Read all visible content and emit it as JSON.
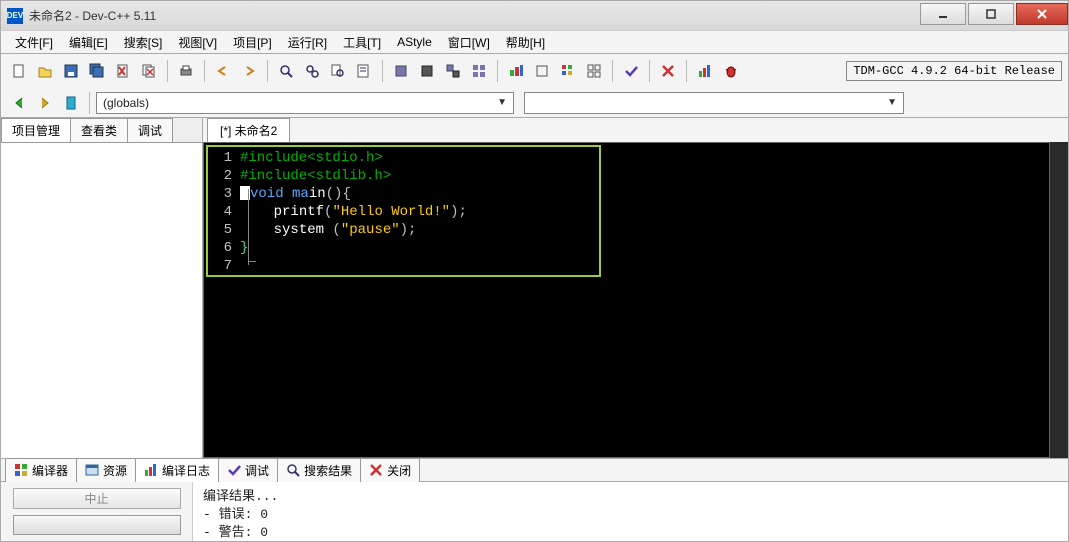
{
  "window": {
    "title": "未命名2 - Dev-C++ 5.11",
    "app_abbrev": "DEV"
  },
  "menu": {
    "file": "文件[F]",
    "edit": "编辑[E]",
    "search": "搜索[S]",
    "view": "视图[V]",
    "project": "项目[P]",
    "run": "运行[R]",
    "tools": "工具[T]",
    "astyle": "AStyle",
    "window": "窗口[W]",
    "help": "帮助[H]"
  },
  "toolbar2": {
    "scope_combo": "(globals)",
    "member_combo": ""
  },
  "compiler_label": "TDM-GCC 4.9.2 64-bit Release",
  "left_tabs": {
    "t1": "项目管理",
    "t2": "查看类",
    "t3": "调试"
  },
  "editor_tab": "[*] 未命名2",
  "code": {
    "lines": [
      {
        "n": "1",
        "type": "comment",
        "text": "#include<stdio.h>"
      },
      {
        "n": "2",
        "type": "comment",
        "text": "#include<stdlib.h>"
      },
      {
        "n": "3",
        "type": "main",
        "kw": "void",
        "id": "main",
        "rest": "(){"
      },
      {
        "n": "4",
        "type": "call",
        "indent": "    ",
        "fn": "printf",
        "open": "(",
        "str": "\"Hello World!\"",
        "close": ");"
      },
      {
        "n": "5",
        "type": "call",
        "indent": "    ",
        "fn": "system",
        "open": " (",
        "str": "\"pause\"",
        "close": ");"
      },
      {
        "n": "6",
        "type": "brace",
        "text": "}"
      },
      {
        "n": "7",
        "type": "empty",
        "text": ""
      }
    ]
  },
  "bottom_tabs": {
    "t1": "编译器",
    "t2": "资源",
    "t3": "编译日志",
    "t4": "调试",
    "t5": "搜索结果",
    "t6": "关闭"
  },
  "bottom_panel": {
    "stop_btn": "中止",
    "header": "编译结果...",
    "err_label": "- 错误: 0",
    "warn_label": "- 警告: 0"
  }
}
